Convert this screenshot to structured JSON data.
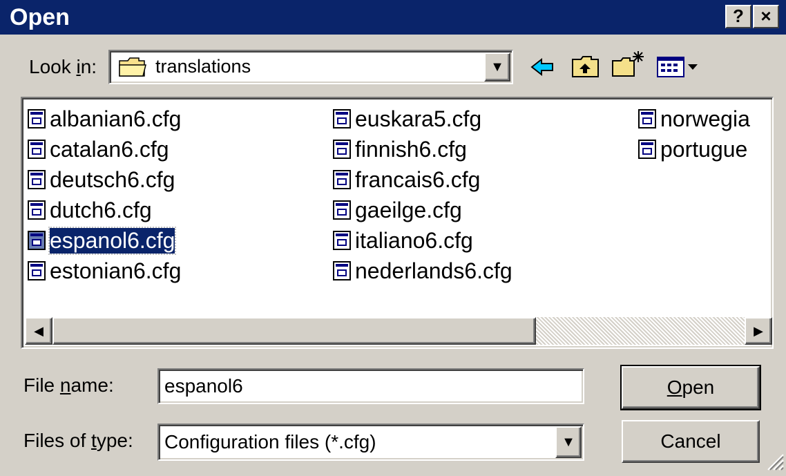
{
  "window": {
    "title": "Open",
    "help_label": "?",
    "close_label": "×"
  },
  "toolbar": {
    "look_in_prefix": "Look ",
    "look_in_accel": "i",
    "look_in_suffix": "n:",
    "current_folder": "translations",
    "icons": [
      "folder-icon",
      "back-arrow-icon",
      "up-folder-icon",
      "new-folder-icon",
      "view-menu-icon"
    ]
  },
  "files": {
    "column1": [
      "albanian6.cfg",
      "catalan6.cfg",
      "deutsch6.cfg",
      "dutch6.cfg",
      "espanol6.cfg",
      "estonian6.cfg"
    ],
    "column2": [
      "euskara5.cfg",
      "finnish6.cfg",
      "francais6.cfg",
      "gaeilge.cfg",
      "italiano6.cfg",
      "nederlands6.cfg"
    ],
    "column3": [
      "norwegia",
      "portugue"
    ],
    "selected": "espanol6.cfg"
  },
  "form": {
    "filename_prefix": "File ",
    "filename_accel": "n",
    "filename_suffix": "ame:",
    "filename_value": "espanol6",
    "filetype_prefix": "Files of ",
    "filetype_accel": "t",
    "filetype_suffix": "ype:",
    "filetype_value": "Configuration files (*.cfg)"
  },
  "buttons": {
    "open_accel": "O",
    "open_rest": "pen",
    "cancel": "Cancel"
  },
  "colors": {
    "titlebar": "#0a246a",
    "face": "#d4d0c8",
    "selection": "#0a246a"
  }
}
